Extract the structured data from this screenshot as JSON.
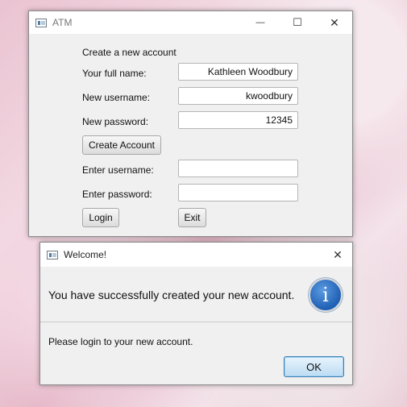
{
  "atm_window": {
    "title": "ATM",
    "controls": {
      "minimize": "—",
      "maximize": "☐",
      "close": "✕"
    },
    "create_heading": "Create a new account",
    "full_name_label": "Your full name:",
    "full_name_value": "Kathleen Woodbury",
    "new_username_label": "New username:",
    "new_username_value": "kwoodbury",
    "new_password_label": "New password:",
    "new_password_value": "12345",
    "create_button": "Create Account",
    "enter_username_label": "Enter username:",
    "enter_username_value": "",
    "enter_password_label": "Enter password:",
    "enter_password_value": "",
    "login_button": "Login",
    "exit_button": "Exit"
  },
  "welcome_dialog": {
    "title": "Welcome!",
    "close": "✕",
    "header_text": "You have successfully created your new account.",
    "info_icon_glyph": "i",
    "content_text": "Please login to your new account.",
    "ok_button": "OK"
  }
}
